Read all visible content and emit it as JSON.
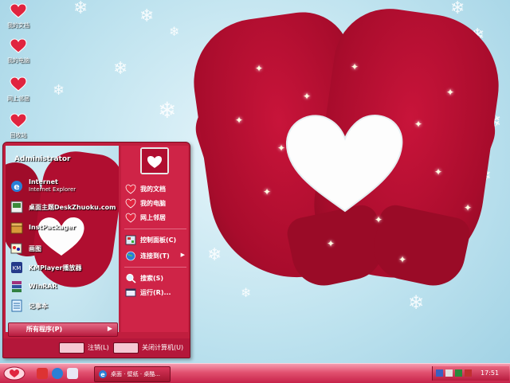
{
  "desktop_icons": [
    {
      "label": "我的文档",
      "icon": "heart-documents-icon"
    },
    {
      "label": "我的电脑",
      "icon": "heart-computer-icon"
    },
    {
      "label": "网上邻居",
      "icon": "heart-network-icon"
    },
    {
      "label": "回收站",
      "icon": "heart-recycle-icon"
    }
  ],
  "start_menu": {
    "user": "Administrator",
    "pinned": [
      {
        "title": "Internet",
        "subtitle": "Internet Explorer",
        "icon": "internet-explorer-icon"
      },
      {
        "title": "桌面主题DeskZhuoku.com",
        "icon": "theme-app-icon"
      },
      {
        "title": "InstPackager",
        "icon": "package-icon"
      },
      {
        "title": "画图",
        "icon": "paint-icon"
      },
      {
        "title": "KMPlayer播放器",
        "icon": "kmplayer-icon"
      },
      {
        "title": "WinRAR",
        "icon": "winrar-icon"
      },
      {
        "title": "记事本",
        "icon": "notepad-icon"
      }
    ],
    "all_programs": "所有程序(P)",
    "right": [
      {
        "label": "我的文档",
        "icon": "heart-documents-icon"
      },
      {
        "label": "我的电脑",
        "icon": "heart-computer-icon"
      },
      {
        "label": "网上邻居",
        "icon": "heart-network-icon"
      },
      {
        "label": "控制面板(C)",
        "icon": "control-panel-icon"
      },
      {
        "label": "连接到(T)",
        "icon": "globe-icon"
      },
      {
        "label": "搜索(S)",
        "icon": "search-icon"
      },
      {
        "label": "运行(R)...",
        "icon": "run-icon"
      }
    ],
    "logoff": "注销(L)",
    "shutdown": "关闭计算机(U)"
  },
  "taskbar": {
    "task_item": "桌面 · 壁纸 · 桌酷...",
    "clock": "17:51"
  },
  "colors": {
    "accent": "#c01e3e",
    "taskbar": "#e2506f",
    "sky": "#bfe3ef",
    "mitten": "#b00e30"
  }
}
